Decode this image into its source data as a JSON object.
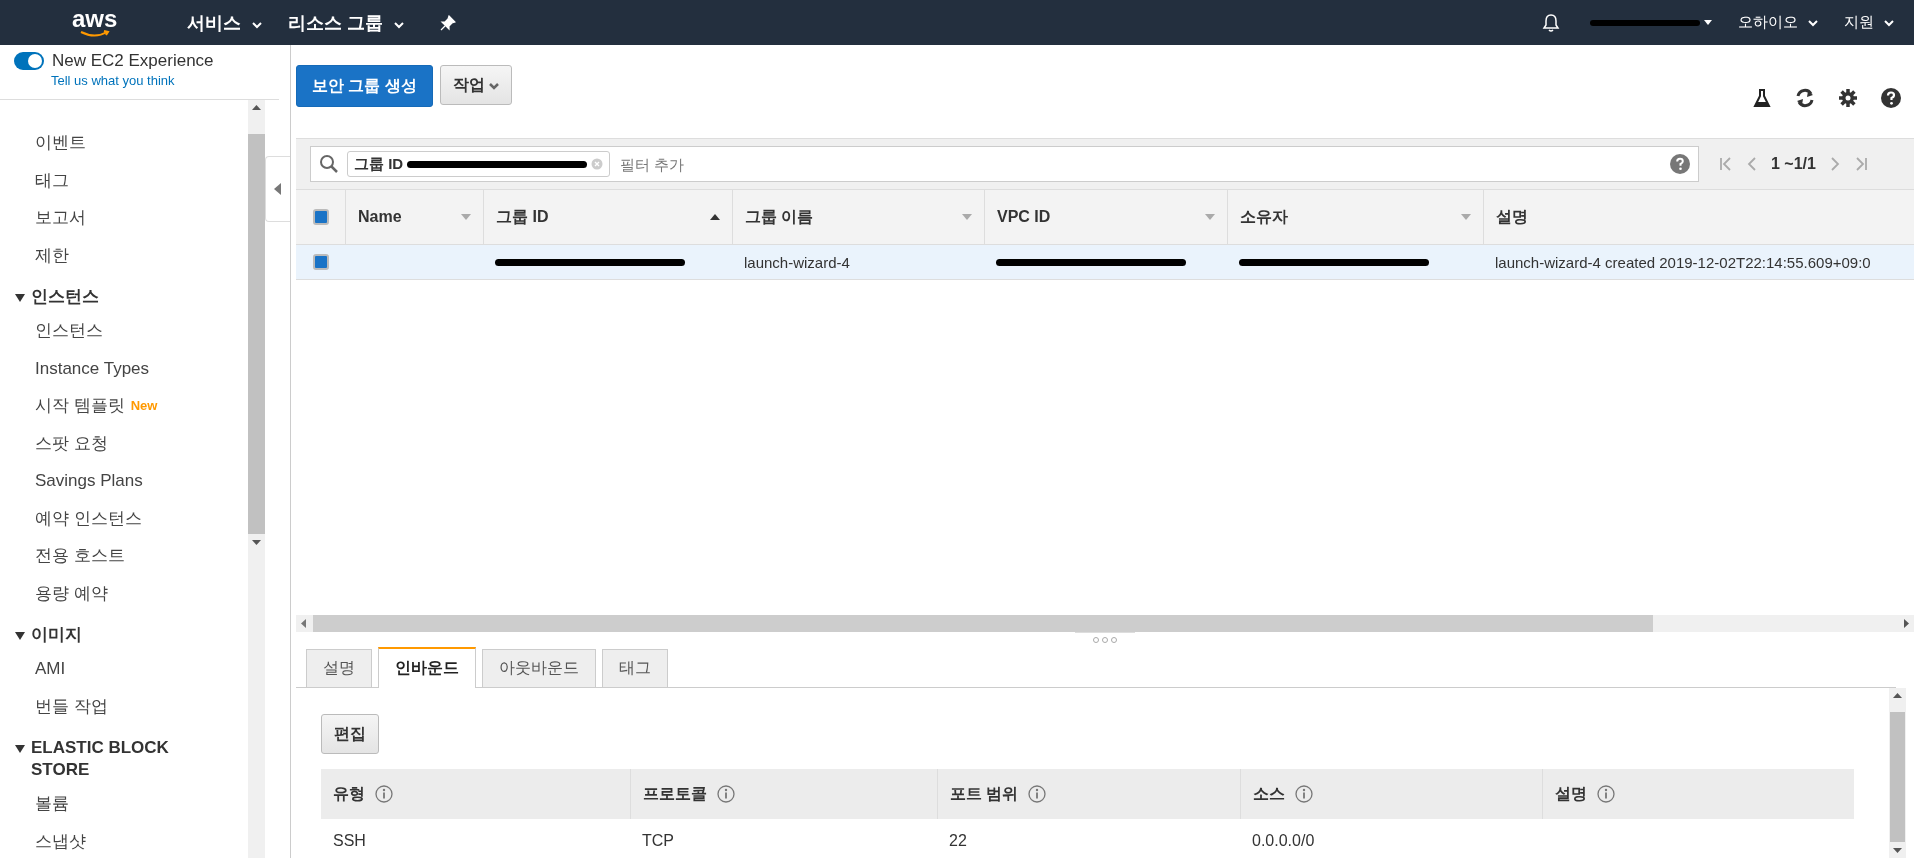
{
  "topbar": {
    "logo": "aws",
    "menus": [
      {
        "label": "서비스"
      },
      {
        "label": "리소스 그룹"
      }
    ],
    "account": {
      "redacted": true
    },
    "region": "오하이오",
    "support": "지원"
  },
  "sidebar": {
    "toggle": {
      "label": "New EC2 Experience",
      "on": true
    },
    "feedback_link": "Tell us what you think",
    "nav": [
      {
        "kind": "item",
        "label": "이벤트"
      },
      {
        "kind": "item",
        "label": "태그"
      },
      {
        "kind": "item",
        "label": "보고서"
      },
      {
        "kind": "item",
        "label": "제한"
      },
      {
        "kind": "section",
        "label": "인스턴스",
        "expanded": true,
        "children": [
          {
            "label": "인스턴스"
          },
          {
            "label": "Instance Types"
          },
          {
            "label": "시작 템플릿",
            "badge": "New"
          },
          {
            "label": "스팟 요청"
          },
          {
            "label": "Savings Plans"
          },
          {
            "label": "예약 인스턴스"
          },
          {
            "label": "전용 호스트"
          },
          {
            "label": "용량 예약"
          }
        ]
      },
      {
        "kind": "section",
        "label": "이미지",
        "expanded": true,
        "children": [
          {
            "label": "AMI"
          },
          {
            "label": "번들 작업"
          }
        ]
      },
      {
        "kind": "section",
        "label": "ELASTIC BLOCK STORE",
        "expanded": true,
        "children": [
          {
            "label": "볼륨"
          },
          {
            "label": "스냅샷"
          }
        ]
      }
    ]
  },
  "toolbar": {
    "create_button": "보안 그룹 생성",
    "actions_button": "작업"
  },
  "filter": {
    "chip_label": "그룹 ID",
    "placeholder": "필터 추가",
    "pagination": "1 ~1/1"
  },
  "table": {
    "header_checked": true,
    "columns": [
      {
        "label": "Name",
        "sorted": false
      },
      {
        "label": "그룹 ID",
        "sorted": true
      },
      {
        "label": "그룹 이름",
        "sorted": false
      },
      {
        "label": "VPC ID",
        "sorted": false
      },
      {
        "label": "소유자",
        "sorted": false
      },
      {
        "label": "설명"
      }
    ],
    "rows": [
      {
        "selected": true,
        "checked": true,
        "cells": [
          {
            "kind": "blank"
          },
          {
            "kind": "redacted"
          },
          {
            "kind": "text",
            "text": "launch-wizard-4"
          },
          {
            "kind": "redacted"
          },
          {
            "kind": "redacted"
          },
          {
            "kind": "text",
            "text": "launch-wizard-4 created 2019-12-02T22:14:55.609+09:0"
          }
        ]
      }
    ]
  },
  "details": {
    "tabs": [
      {
        "label": "설명",
        "selected": false
      },
      {
        "label": "인바운드",
        "selected": true
      },
      {
        "label": "아웃바운드",
        "selected": false
      },
      {
        "label": "태그",
        "selected": false
      }
    ],
    "edit_button": "편집",
    "columns": [
      "유형",
      "프로토콜",
      "포트 범위",
      "소스",
      "설명"
    ],
    "rows": [
      {
        "cells": [
          "SSH",
          "TCP",
          "22",
          "0.0.0.0/0"
        ]
      }
    ]
  }
}
